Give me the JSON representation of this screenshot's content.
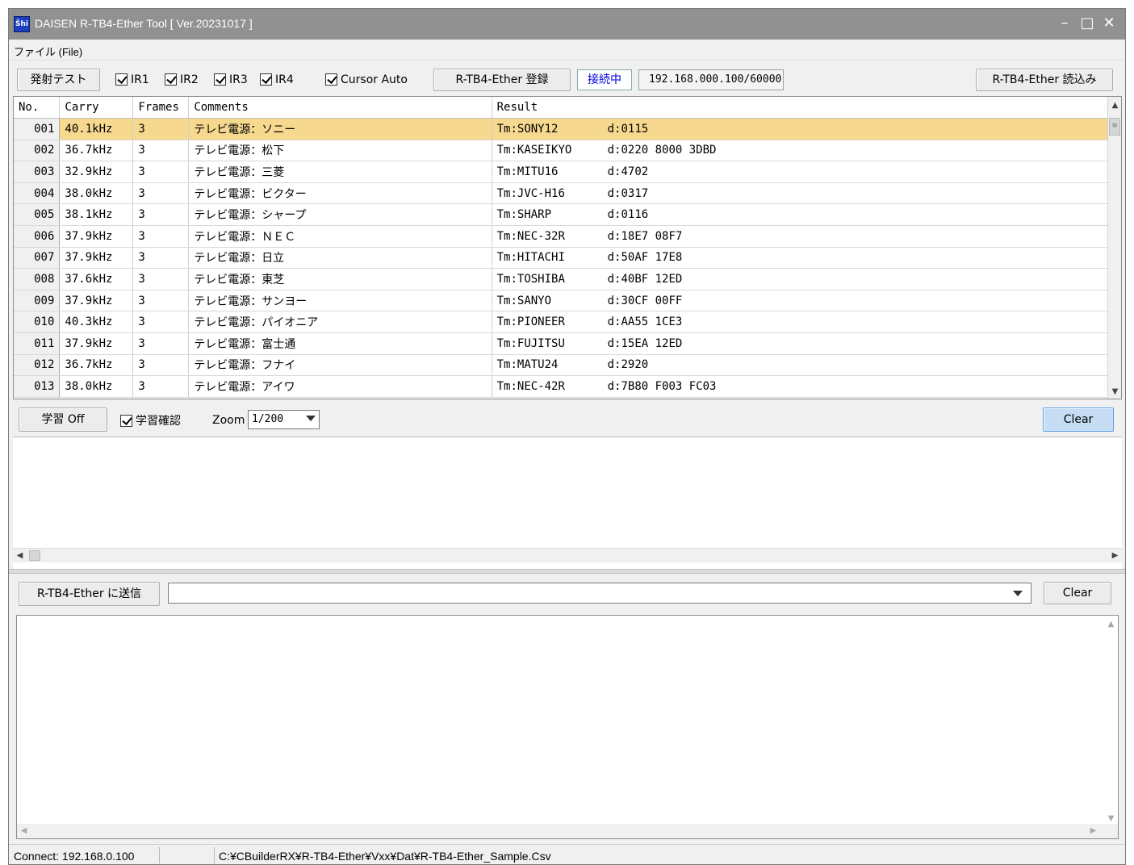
{
  "window": {
    "title": "DAISEN R-TB4-Ether Tool  [ Ver.20231017 ]",
    "icon_label": "Ŝhi",
    "minimize": "–",
    "maximize": "□",
    "close": "✕"
  },
  "menu": {
    "file": "ファイル (File)"
  },
  "toolbar1": {
    "fire_test": "発射テスト",
    "ir1": "IR1",
    "ir2": "IR2",
    "ir3": "IR3",
    "ir4": "IR4",
    "cursor_auto": "Cursor Auto",
    "register": "R-TB4-Ether 登録",
    "connecting": "接続中",
    "ip_port": "192.168.000.100/60000",
    "read": "R-TB4-Ether 読込み"
  },
  "grid": {
    "headers": [
      "No.",
      "Carry",
      "Frames",
      "Comments",
      "Result"
    ],
    "rows": [
      {
        "no": "001",
        "carry": "40.1kHz",
        "frames": "3",
        "comment": "テレビ電源：ソニー",
        "tm": "Tm:SONY12",
        "d": "d:0115"
      },
      {
        "no": "002",
        "carry": "36.7kHz",
        "frames": "3",
        "comment": "テレビ電源：松下",
        "tm": "Tm:KASEIKYO",
        "d": "d:0220 8000 3DBD"
      },
      {
        "no": "003",
        "carry": "32.9kHz",
        "frames": "3",
        "comment": "テレビ電源：三菱",
        "tm": "Tm:MITU16",
        "d": "d:4702"
      },
      {
        "no": "004",
        "carry": "38.0kHz",
        "frames": "3",
        "comment": "テレビ電源：ビクター",
        "tm": "Tm:JVC-H16",
        "d": "d:0317"
      },
      {
        "no": "005",
        "carry": "38.1kHz",
        "frames": "3",
        "comment": "テレビ電源：シャープ",
        "tm": "Tm:SHARP",
        "d": "d:0116"
      },
      {
        "no": "006",
        "carry": "37.9kHz",
        "frames": "3",
        "comment": "テレビ電源：ＮＥＣ",
        "tm": "Tm:NEC-32R",
        "d": "d:18E7 08F7"
      },
      {
        "no": "007",
        "carry": "37.9kHz",
        "frames": "3",
        "comment": "テレビ電源：日立",
        "tm": "Tm:HITACHI",
        "d": "d:50AF 17E8"
      },
      {
        "no": "008",
        "carry": "37.6kHz",
        "frames": "3",
        "comment": "テレビ電源：東芝",
        "tm": "Tm:TOSHIBA",
        "d": "d:40BF 12ED"
      },
      {
        "no": "009",
        "carry": "37.9kHz",
        "frames": "3",
        "comment": "テレビ電源：サンヨー",
        "tm": "Tm:SANYO",
        "d": "d:30CF 00FF"
      },
      {
        "no": "010",
        "carry": "40.3kHz",
        "frames": "3",
        "comment": "テレビ電源：パイオニア",
        "tm": "Tm:PIONEER",
        "d": "d:AA55 1CE3"
      },
      {
        "no": "011",
        "carry": "37.9kHz",
        "frames": "3",
        "comment": "テレビ電源：富士通",
        "tm": "Tm:FUJITSU",
        "d": "d:15EA 12ED"
      },
      {
        "no": "012",
        "carry": "36.7kHz",
        "frames": "3",
        "comment": "テレビ電源：フナイ",
        "tm": "Tm:MATU24",
        "d": "d:2920"
      },
      {
        "no": "013",
        "carry": "38.0kHz",
        "frames": "3",
        "comment": "テレビ電源：アイワ",
        "tm": "Tm:NEC-42R",
        "d": "d:7B80 F003 FC03"
      }
    ]
  },
  "toolbar2": {
    "learn": "学習 Off",
    "learn_confirm": "学習確認",
    "zoom_label": "Zoom",
    "zoom_value": "1/200",
    "clear": "Clear"
  },
  "toolbar3": {
    "send": "R-TB4-Ether に送信",
    "command": "",
    "clear": "Clear"
  },
  "status": {
    "connect": "Connect: 192.168.0.100",
    "path": "C:¥CBuilderRX¥R-TB4-Ether¥Vxx¥Dat¥R-TB4-Ether_Sample.Csv"
  },
  "colors": {
    "selected_row": "#f6d88f",
    "connecting_text": "#0000e0",
    "clear_button": "#c6ddf5"
  }
}
